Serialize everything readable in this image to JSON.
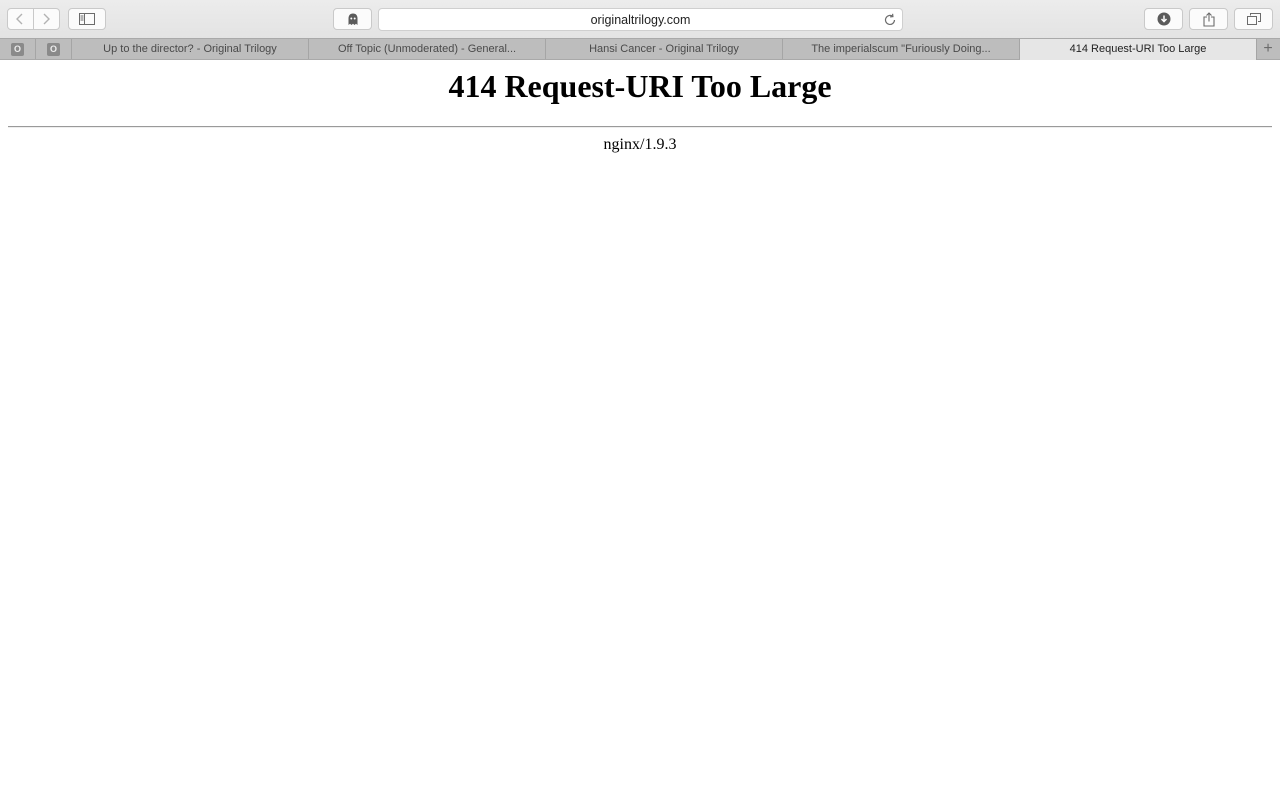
{
  "browser": {
    "address": "originaltrilogy.com",
    "icons": {
      "back": "chevron-left-icon",
      "forward": "chevron-right-icon",
      "sidebar": "sidebar-icon",
      "extension": "ghostery-ghost-icon",
      "reload": "reload-icon",
      "downloads": "download-icon",
      "share": "share-icon",
      "tabs": "show-all-tabs-icon",
      "new_tab": "plus-icon"
    }
  },
  "pinned_tabs": [
    {
      "letter": "O"
    },
    {
      "letter": "O"
    }
  ],
  "tabs": [
    {
      "label": "Up to the director? - Original Trilogy"
    },
    {
      "label": "Off Topic (Unmoderated) - General..."
    },
    {
      "label": "Hansi Cancer - Original Trilogy"
    },
    {
      "label": "The imperialscum \"Furiously Doing..."
    },
    {
      "label": "414 Request-URI Too Large",
      "active": true
    }
  ],
  "page": {
    "title": "414 Request-URI Too Large",
    "server": "nginx/1.9.3"
  }
}
